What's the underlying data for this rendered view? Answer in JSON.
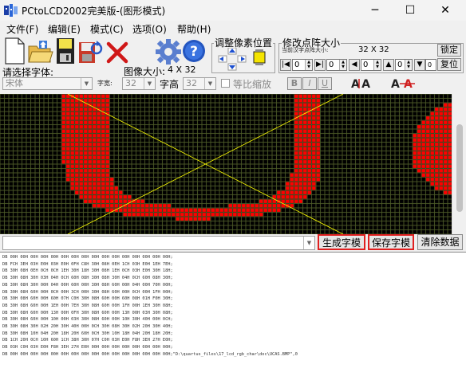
{
  "window": {
    "title": "PCtoLCD2002完美版-(图形模式)",
    "minimize_glyph": "─",
    "maximize_glyph": "☐",
    "close_glyph": "✕"
  },
  "menu": [
    {
      "label": "文件(F)"
    },
    {
      "label": "编辑(E)"
    },
    {
      "label": "模式(C)"
    },
    {
      "label": "选项(O)"
    },
    {
      "label": "帮助(H)"
    }
  ],
  "toolbar": {
    "icons": [
      "new-file-icon",
      "open-folder-icon",
      "save-disk-icon",
      "save-as-icon",
      "delete-icon",
      "settings-gear-icon",
      "help-icon"
    ],
    "adjust_group_title": "调整像素位置",
    "resize_group_title": "修改点阵大小",
    "current_size_label": "当前汉字点阵大小:",
    "current_size": "32 X 32",
    "lock_button": "锁定",
    "restore_button": "复位",
    "spin_values": [
      "0",
      "0",
      "0",
      "0",
      "0",
      "0"
    ]
  },
  "font_row": {
    "select_font_label": "请选择字体:",
    "font_value": "宋体",
    "char_width_label": "字宽:",
    "char_width_value": "32",
    "image_size_label": "图像大小:",
    "image_size_value": "4 X 32",
    "char_height_label": "字高",
    "char_height_value": "32",
    "proportional_label": "等比缩放",
    "bold_label": "B",
    "italic_label": "I",
    "underline_label": "U"
  },
  "matrix": {
    "text": "UCAS",
    "on_color": "#ff0000",
    "off_color": "#000000",
    "grid_color": "#556b2f",
    "background": "#2b2b14",
    "diagonal_color": "#ffff00"
  },
  "buttons": {
    "generate": "生成字模",
    "save": "保存字模",
    "clear": "清除数据"
  },
  "output_lines": [
    "DB 00H 00H 00H 00H 00H 00H 00H 00H 00H 00H 00H 00H 00H 00H 00H 00H;",
    "DB FCH 3EH 03H E0H 03H E0H 0FH C8H 30H 08H 0EH 1CH 03H E0H 1EH 7EH;",
    "DB 30H 08H 0EH 0CH 0CH 1EH 30H 18H 30H 08H 1EH 0CH 03H E0H 30H 18H;",
    "DB 30H 08H 30H 03H 04H 0CH 60H 08H 30H 08H 30H 04H 0CH 60H 08H 30H;",
    "DB 30H 08H 30H 00H 04H 00H 60H 00H 30H 08H 60H 00H 04H 00H 70H 00H;",
    "DB 30H 08H 60H 00H 0CH 00H 3CH 00H 30H 08H 60H 00H 0CH 00H 1FH 00H;",
    "DB 30H 08H 60H 00H 60H 07H C0H 30H 08H 60H 00H 60H 08H 01H F0H 30H;",
    "DB 30H 08H 60H 00H 1EH 00H 7EH 30H 08H 60H 00H 1FH 00H 1EH 30H 08H;",
    "DB 30H 08H 60H 00H 13H 00H 0FH 30H 08H 60H 00H 13H 00H 03H 30H 08H;",
    "DB 30H 08H 60H 00H 10H 00H 03H 30H 08H 60H 00H 10H 30H 40H 00H 0CH;",
    "DB 30H 08H 30H 02H 20H 30H 40H 00H 0CH 30H 08H 30H 02H 20H 30H 40H;",
    "DB 30H 08H 10H 04H 20H 18H 20H 60H 0CH 30H 10H 18H 04H 20H 18H 20H;",
    "DB 1CH 20H 0CH 10H 60H 1CH 38H 30H 07H C0H 03H E0H F8H 3EH 27H E0H;",
    "DB 03H C0H 03H E0H F8H 3EH 27H E0H 00H 00H 00H 00H 00H 00H 00H 00H;",
    "DB 00H 00H 00H 00H 00H 00H 00H 00H 00H 00H 00H 00H 00H 00H 00H 00H;\"D:\\quartus_files\\17_lcd_rgb_char\\doc\\UCAS.BMP\",0"
  ]
}
